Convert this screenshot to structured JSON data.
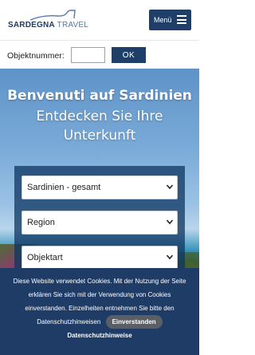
{
  "header": {
    "logo_bold": "SARDEGNA",
    "logo_light": "TRAVEL",
    "menu_label": "Menü"
  },
  "search": {
    "label": "Objektnummer:",
    "input_value": "",
    "button_label": "OK"
  },
  "hero": {
    "title": "Benvenuti auf Sardinien",
    "subtitle_line1": "Entdecken Sie Ihre",
    "subtitle_line2": "Unterkunft"
  },
  "filters": {
    "region_all": "Sardinien - gesamt",
    "region": "Region",
    "object_type": "Objektart"
  },
  "cookie": {
    "line1": "Diese Website verwendet Cookies. Mit der Nutzung der Seite",
    "line2": "erklären Sie sich mit der Verwendung von Cookies",
    "line3": "einverstanden. Einzelheiten entnehmen Sie bitte den",
    "line4": "Datenschutzhinweisen",
    "accept_label": "Einverstanden",
    "privacy_link": "Datenschutzhinweise"
  },
  "colors": {
    "brand_dark": "#1f3f68",
    "brand_light": "#4f7bb0",
    "cookie_bg": "#1e3c66"
  }
}
